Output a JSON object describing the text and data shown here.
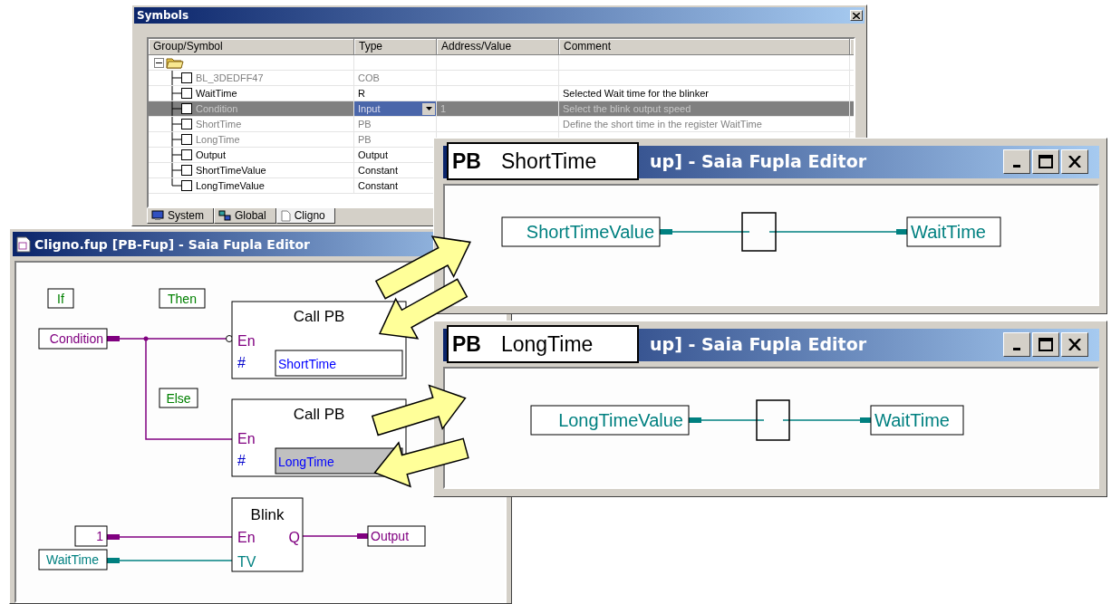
{
  "symbols_window": {
    "title": "Symbols",
    "columns": [
      "Group/Symbol",
      "Type",
      "Address/Value",
      "Comment"
    ],
    "rows": [
      {
        "kind": "folder",
        "expanded": true,
        "symbol": "",
        "type": "",
        "address": "",
        "comment": "",
        "selected": false,
        "dimmed": false
      },
      {
        "kind": "symbol",
        "symbol": "BL_3DEDFF47",
        "type": "COB",
        "address": "",
        "comment": "",
        "selected": false,
        "dimmed": true
      },
      {
        "kind": "symbol",
        "symbol": "WaitTime",
        "type": "R",
        "address": "",
        "comment": "Selected Wait time for the blinker",
        "selected": false,
        "dimmed": false
      },
      {
        "kind": "symbol",
        "symbol": "Condition",
        "type": "Input",
        "address": "1",
        "comment": "Select the blink output speed",
        "selected": true,
        "dimmed": false
      },
      {
        "kind": "symbol",
        "symbol": "ShortTime",
        "type": "PB",
        "address": "",
        "comment": "Define the short time in the register WaitTime",
        "selected": false,
        "dimmed": true
      },
      {
        "kind": "symbol",
        "symbol": "LongTime",
        "type": "PB",
        "address": "",
        "comment": "",
        "selected": false,
        "dimmed": true
      },
      {
        "kind": "symbol",
        "symbol": "Output",
        "type": "Output",
        "address": "",
        "comment": "",
        "selected": false,
        "dimmed": false
      },
      {
        "kind": "symbol",
        "symbol": "ShortTimeValue",
        "type": "Constant",
        "address": "",
        "comment": "",
        "selected": false,
        "dimmed": false
      },
      {
        "kind": "symbol",
        "symbol": "LongTimeValue",
        "type": "Constant",
        "address": "",
        "comment": "",
        "selected": false,
        "dimmed": false
      }
    ],
    "tabs": [
      {
        "label": "System",
        "selected": false
      },
      {
        "label": "Global",
        "selected": false
      },
      {
        "label": "Cligno",
        "selected": true
      }
    ]
  },
  "main_editor": {
    "title": "Cligno.fup [PB-Fup] - Saia Fupla Editor",
    "comment_labels": [
      "If",
      "Then",
      "Else"
    ],
    "call_blocks": [
      {
        "title": "Call PB",
        "pins": [
          {
            "text": "En",
            "color": "#800080"
          },
          {
            "text": "#",
            "color": "#0000cc"
          }
        ],
        "parameter": "ShortTime",
        "highlighted": false
      },
      {
        "title": "Call PB",
        "pins": [
          {
            "text": "En",
            "color": "#800080"
          },
          {
            "text": "#",
            "color": "#0000cc"
          }
        ],
        "parameter": "LongTime",
        "highlighted": true
      }
    ],
    "blink_block": {
      "title": "Blink",
      "inputs": [
        {
          "text": "En",
          "color": "#800080"
        },
        {
          "text": "TV",
          "color": "#008080"
        }
      ],
      "output": {
        "text": "Q",
        "color": "#800080"
      }
    },
    "signals": [
      {
        "text": "Condition",
        "color": "#800080"
      },
      {
        "text": "1",
        "color": "#800080"
      },
      {
        "text": "WaitTime",
        "color": "#008080"
      },
      {
        "text": "Output",
        "color": "#800080"
      }
    ]
  },
  "pb_windows": [
    {
      "badge": "PB",
      "name": "ShortTime",
      "title": "up] - Saia Fupla Editor",
      "input": "ShortTimeValue",
      "output": "WaitTime"
    },
    {
      "badge": "PB",
      "name": "LongTime",
      "title": "up] - Saia Fupla Editor",
      "input": "LongTimeValue",
      "output": "WaitTime"
    }
  ]
}
